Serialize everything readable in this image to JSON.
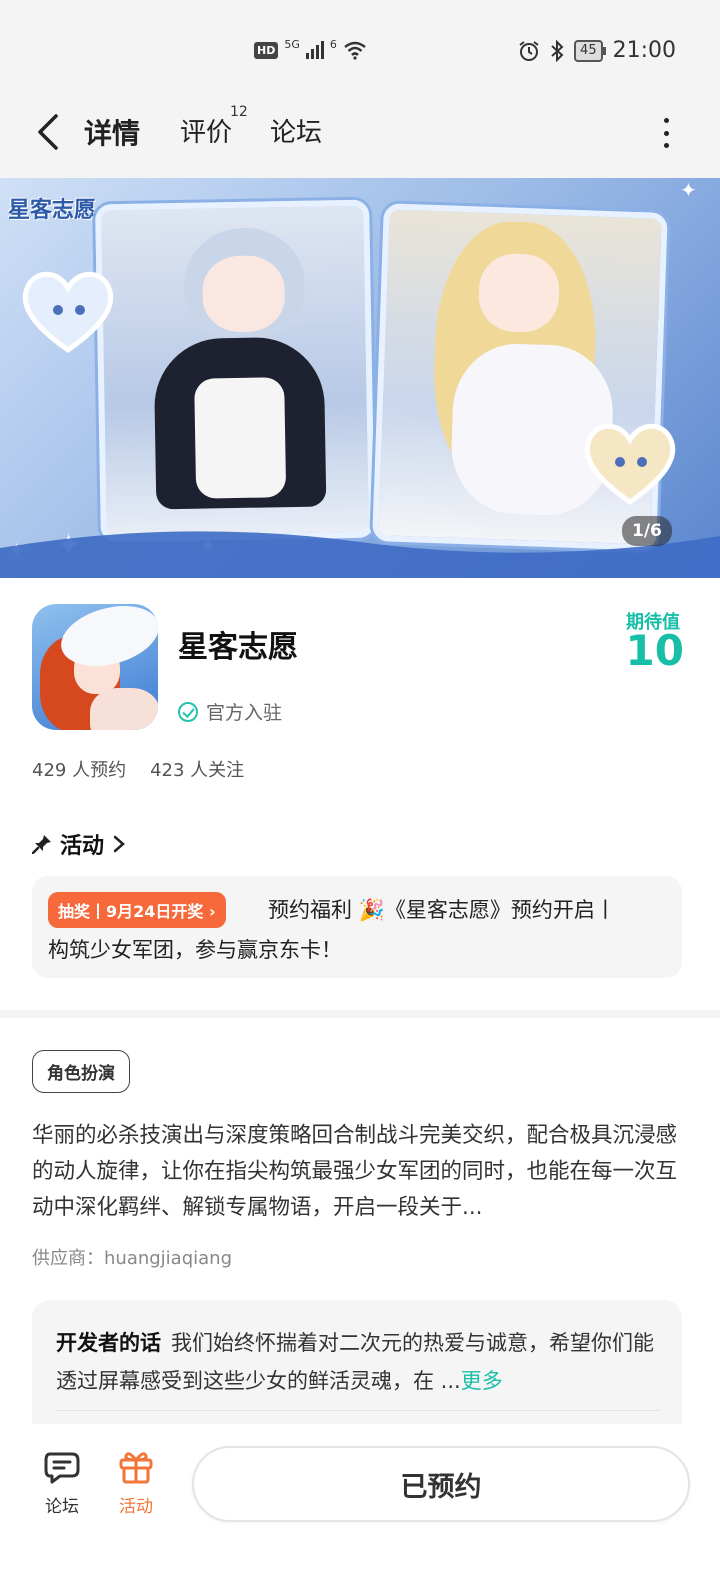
{
  "status_bar": {
    "hd_badge": "HD",
    "network": "5G",
    "wifi_badge": "6",
    "battery": "45",
    "time": "21:00"
  },
  "nav": {
    "tabs": [
      {
        "label": "详情",
        "active": true
      },
      {
        "label": "评价",
        "badge": "12"
      },
      {
        "label": "论坛"
      }
    ]
  },
  "banner": {
    "logo_text": "星客志愿",
    "pager": "1/6"
  },
  "app": {
    "name": "星客志愿",
    "verified_label": "官方入驻",
    "expect_label": "期待值",
    "expect_value": "10",
    "reserve_count": "429 人预约",
    "follow_count": "423 人关注"
  },
  "activity": {
    "section_title": "活动",
    "tag": "抽奖丨9月24日开奖 ›",
    "line1": "预约福利 🎉《星客志愿》预约开启丨",
    "line2": "构筑少女军团，参与赢京东卡！"
  },
  "detail": {
    "genre_tag": "角色扮演",
    "description": "华丽的必杀技演出与深度策略回合制战斗完美交织，配合极具沉浸感的动人旋律，让你在指尖构筑最强少女军团的同时，也能在每一次互动中深化羁绊、解锁专属物语，开启一段关于...",
    "supplier": "供应商：huangjiaqiang"
  },
  "developer": {
    "title": "开发者的话",
    "text": "我们始终怀揣着对二次元的热爱与诚意，希望你们能透过屏幕感受到这些少女的鲜活灵魂，在 ...",
    "more": "更多"
  },
  "bottom_bar": {
    "forum_label": "论坛",
    "activity_label": "活动",
    "reserve_button": "已预约"
  },
  "colors": {
    "accent": "#18bfa8",
    "tab_underline": "#25d4bd",
    "lottery_tag": "#f7683a",
    "activity_nav": "#f17637"
  }
}
